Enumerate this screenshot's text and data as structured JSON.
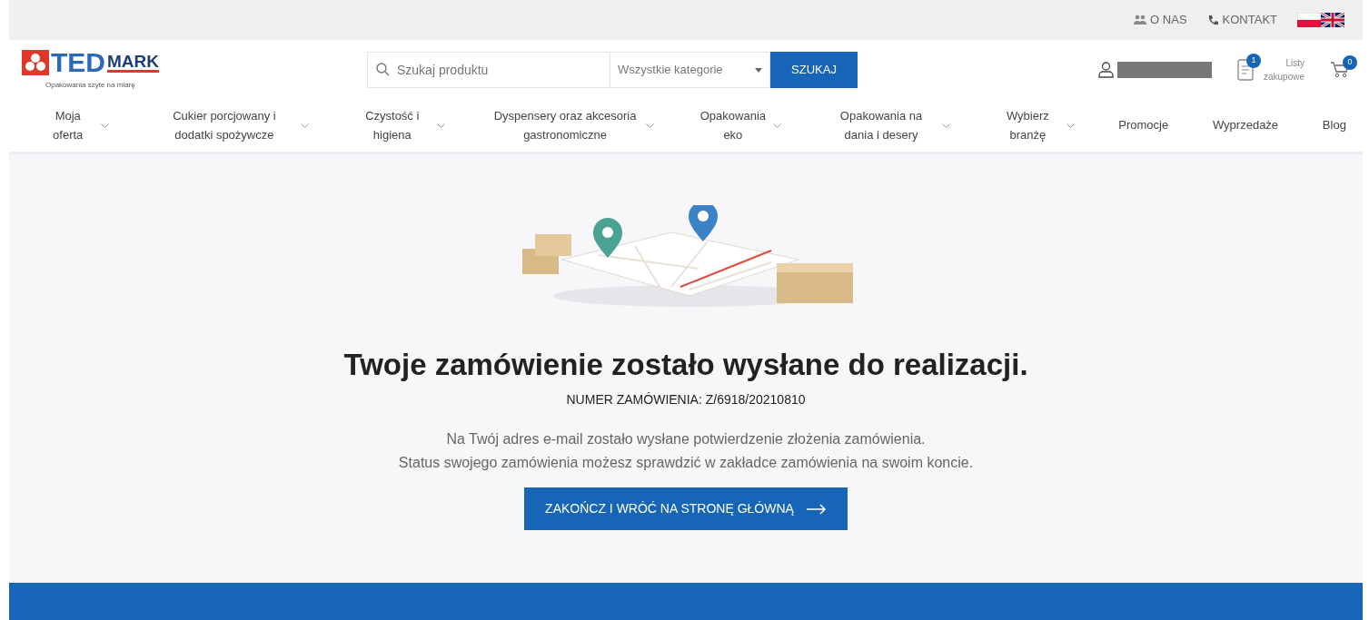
{
  "top_links": [
    {
      "kind": "people",
      "label": "O NAS"
    },
    {
      "kind": "phone",
      "label": "KONTAKT"
    }
  ],
  "languages": [
    {
      "kind": "pl"
    },
    {
      "kind": "en"
    }
  ],
  "logo": {
    "brand_main": "TED",
    "brand_secondary": "MARK",
    "tagline": "Opakowania szyte na miarę"
  },
  "search": {
    "placeholder": "Szukaj produktu",
    "category": "Wszystkie kategorie",
    "button": "SZUKAJ"
  },
  "shopping_lists": {
    "badge": "1",
    "label": "Listy zakupowe"
  },
  "cart": {
    "badge": "0"
  },
  "nav": [
    {
      "label": "Moja oferta",
      "dropdown": true
    },
    {
      "label": "Cukier porcjowany i dodatki spożywcze",
      "dropdown": true
    },
    {
      "label": "Czystość i higiena",
      "dropdown": true
    },
    {
      "label": "Dyspensery oraz akcesoria gastronomiczne",
      "dropdown": true
    },
    {
      "label": "Opakowania eko",
      "dropdown": true
    },
    {
      "label": "Opakowania na dania i desery",
      "dropdown": true
    },
    {
      "label": "Wybierz branżę",
      "dropdown": true
    },
    {
      "label": "Promocje",
      "dropdown": false
    },
    {
      "label": "Wyprzedaże",
      "dropdown": false
    },
    {
      "label": "Blog",
      "dropdown": false
    }
  ],
  "confirmation": {
    "title": "Twoje zamówienie zostało wysłane do realizacji.",
    "order_number": "NUMER ZAMÓWIENIA: Z/6918/20210810",
    "messages": [
      "Na Twój adres e-mail zostało wysłane potwierdzenie złożenia zamówienia.",
      "Status swojego zamówienia możesz sprawdzić w zakładce zamówienia na swoim koncie."
    ],
    "button": "ZAKOŃCZ I WRÓĆ NA STRONĘ GŁÓWNĄ"
  }
}
